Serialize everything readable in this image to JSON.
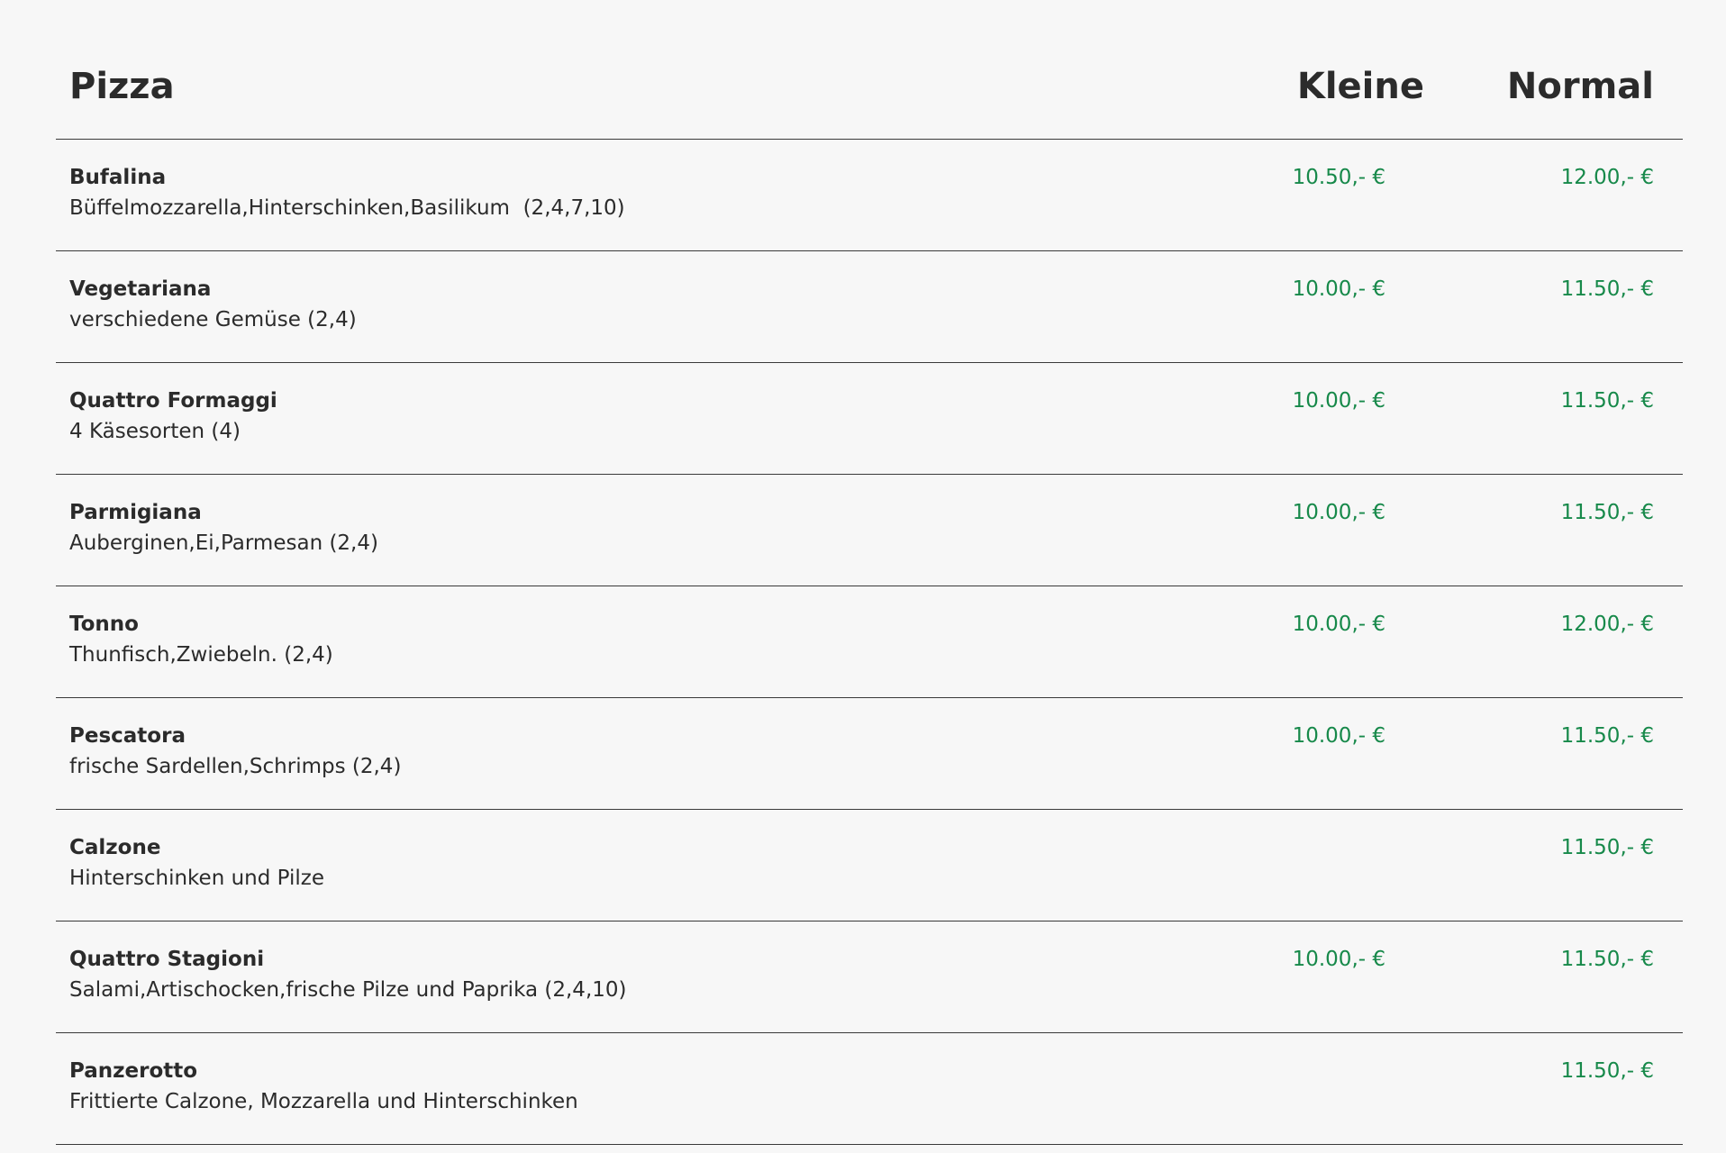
{
  "header": {
    "title": "Pizza",
    "col_small": "Kleine",
    "col_normal": "Normal"
  },
  "items": [
    {
      "name": "Bufalina",
      "desc": "Büffelmozzarella,Hinterschinken,Basilikum  (2,4,7,10)",
      "small": "10.50,- €",
      "normal": "12.00,- €"
    },
    {
      "name": "Vegetariana",
      "desc": "verschiedene Gemüse (2,4)",
      "small": "10.00,- €",
      "normal": "11.50,- €"
    },
    {
      "name": "Quattro Formaggi",
      "desc": "4 Käsesorten (4)",
      "small": "10.00,- €",
      "normal": "11.50,- €"
    },
    {
      "name": "Parmigiana",
      "desc": "Auberginen,Ei,Parmesan (2,4)",
      "small": "10.00,- €",
      "normal": "11.50,- €"
    },
    {
      "name": "Tonno",
      "desc": "Thunfisch,Zwiebeln. (2,4)",
      "small": "10.00,- €",
      "normal": "12.00,- €"
    },
    {
      "name": "Pescatora",
      "desc": "frische Sardellen,Schrimps (2,4)",
      "small": "10.00,- €",
      "normal": "11.50,- €"
    },
    {
      "name": "Calzone",
      "desc": "Hinterschinken und Pilze",
      "small": "",
      "normal": "11.50,- €"
    },
    {
      "name": "Quattro Stagioni",
      "desc": "Salami,Artischocken,frische Pilze und Paprika (2,4,10)",
      "small": "10.00,- €",
      "normal": "11.50,- €"
    },
    {
      "name": "Panzerotto",
      "desc": "Frittierte Calzone, Mozzarella und Hinterschinken",
      "small": "",
      "normal": "11.50,- €"
    }
  ],
  "colors": {
    "price": "#17894a",
    "text": "#2b2b2b",
    "background": "#f7f7f7",
    "divider": "#3a3a3a"
  }
}
